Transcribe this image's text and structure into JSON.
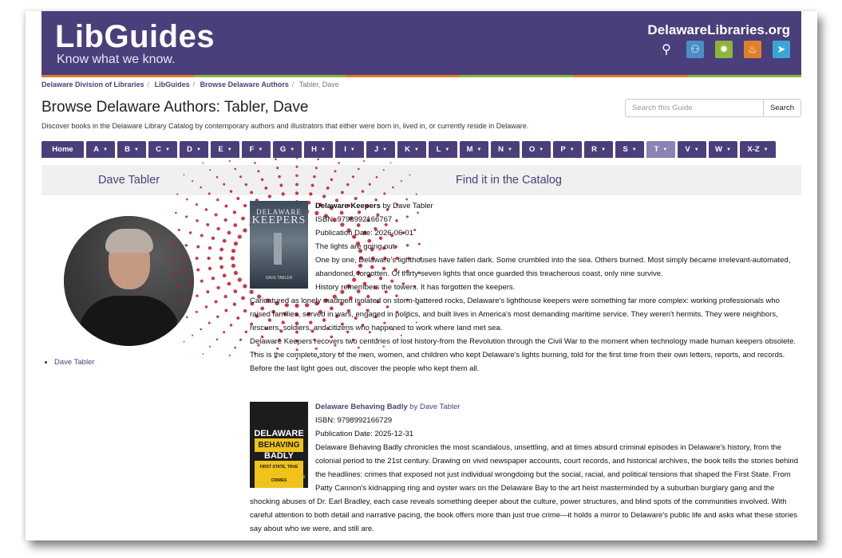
{
  "banner": {
    "logo": "LibGuides",
    "tagline": "Know what we know.",
    "site_name": "DelawareLibraries.org",
    "icons": [
      "search-icon",
      "people-icon",
      "gear-icon",
      "flame-icon",
      "bird-icon"
    ]
  },
  "breadcrumb": [
    "Delaware Division of Libraries",
    "LibGuides",
    "Browse Delaware Authors",
    "Tabler, Dave"
  ],
  "page": {
    "title": "Browse Delaware Authors: Tabler, Dave",
    "description": "Discover books in the Delaware Library Catalog by contemporary authors and illustrators that either were born in, lived in, or currently reside in Delaware."
  },
  "search": {
    "placeholder": "Search this Guide",
    "button": "Search"
  },
  "tabs": [
    "Home",
    "A",
    "B",
    "C",
    "D",
    "E",
    "F",
    "G",
    "H",
    "I",
    "J",
    "K",
    "L",
    "M",
    "N",
    "O",
    "P",
    "R",
    "S",
    "T",
    "V",
    "W",
    "X-Z"
  ],
  "active_tab": "T",
  "left_box": {
    "title": "Dave Tabler",
    "author_link": "Dave Tabler"
  },
  "right_box": {
    "title": "Find it in the Catalog"
  },
  "books": [
    {
      "title": "Delaware Keepers",
      "by": " by Dave Tabler",
      "isbn": "ISBN: 9798992166767",
      "pub_date": "Publication Date: 2026-06-01",
      "cover": {
        "line1": "DELAWARE",
        "line2": "KEEPERS",
        "author": "DAVE TABLER"
      },
      "paragraphs": [
        "The lights are going out.",
        "One by one, Delaware's lighthouses have fallen dark. Some crumbled into the sea. Others burned. Most simply became irrelevant-automated, abandoned, forgotten. Of thirty-seven lights that once guarded this treacherous coast, only nine survive.",
        "History remembers the towers. It has forgotten the keepers.",
        "Caricatured as lonely madmen isolated on storm-battered rocks, Delaware's lighthouse keepers were something far more complex: working professionals who raised families, served in wars, engaged in politics, and built lives in America's most demanding maritime service. They weren't hermits. They were neighbors, rescuers, soldiers, and citizens who happened to work where land met sea.",
        "Delaware Keepers recovers two centuries of lost history-from the Revolution through the Civil War to the moment when technology made human keepers obsolete. This is the complete story of the men, women, and children who kept Delaware's lights burning, told for the first time from their own letters, reports, and records.",
        "Before the last light goes out, discover the people who kept them all."
      ]
    },
    {
      "title": "Delaware Behaving Badly",
      "by": " by Dave Tabler",
      "isbn": "ISBN: 9798992166729",
      "pub_date": "Publication Date: 2025-12-31",
      "cover": {
        "line1": "DELAWARE",
        "line2": "BEHAVING",
        "line3": "BADLY",
        "line4": "FIRST STATE, TRUE CRIMES",
        "author": "DAVE TABLER"
      },
      "paragraphs": [
        "Delaware Behaving Badly chronicles the most scandalous, unsettling, and at times absurd criminal episodes in Delaware's history, from the colonial period to the 21st century. Drawing on vivid newspaper accounts, court records, and historical archives, the book tells the stories behind the headlines: crimes that exposed not just individual wrongdoing but the social, racial, and political tensions that shaped the First State. From Patty Cannon's kidnapping ring and oyster wars on the Delaware Bay to the art heist masterminded by a suburban burglary gang and the shocking abuses of Dr. Earl Bradley, each case reveals something deeper about the culture, power structures, and blind spots of the communities involved. With careful attention to both detail and narrative pacing, the book offers more than just true crime—it holds a mirror to Delaware's public life and asks what these stories say about who we were, and still are."
      ]
    }
  ],
  "colors": {
    "brand": "#4a3f7a",
    "active_tab": "#8b82b6",
    "burst": "#c0152a"
  }
}
